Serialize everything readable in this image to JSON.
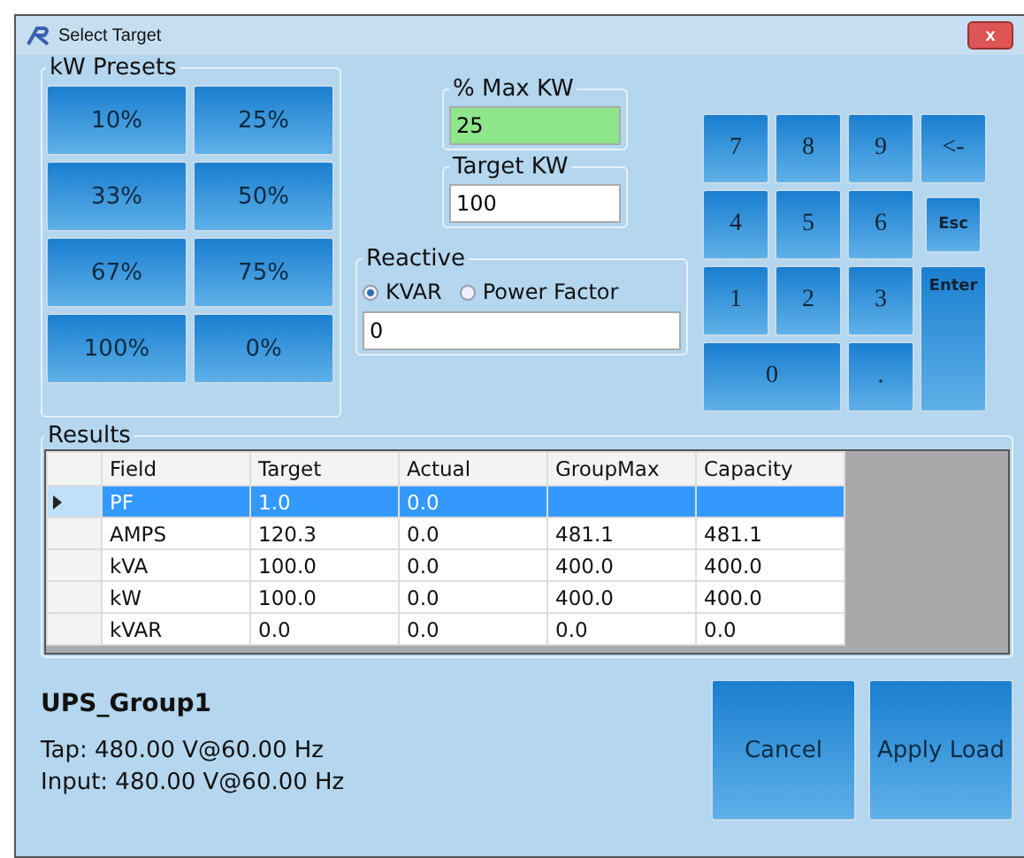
{
  "window": {
    "title": "Select Target",
    "close": "x"
  },
  "presets": {
    "title": "kW Presets",
    "buttons": [
      "10%",
      "25%",
      "33%",
      "50%",
      "67%",
      "75%",
      "100%",
      "0%"
    ]
  },
  "max_kw": {
    "label": "% Max KW",
    "value": "25"
  },
  "target_kw": {
    "label": "Target KW",
    "value": "100"
  },
  "reactive": {
    "title": "Reactive",
    "options": [
      {
        "label": "KVAR",
        "selected": true
      },
      {
        "label": "Power Factor",
        "selected": false
      }
    ],
    "value": "0"
  },
  "keypad": [
    {
      "label": "7",
      "kind": "key"
    },
    {
      "label": "8",
      "kind": "key"
    },
    {
      "label": "9",
      "kind": "key"
    },
    {
      "label": "<-",
      "kind": "key"
    },
    {
      "label": "4",
      "kind": "key"
    },
    {
      "label": "5",
      "kind": "key"
    },
    {
      "label": "6",
      "kind": "key"
    },
    {
      "label": "Esc",
      "kind": "small"
    },
    {
      "label": "1",
      "kind": "key"
    },
    {
      "label": "2",
      "kind": "key"
    },
    {
      "label": "3",
      "kind": "key"
    },
    {
      "label": "Enter",
      "kind": "tall"
    },
    {
      "label": "0",
      "kind": "wide"
    },
    {
      "label": ".",
      "kind": "key"
    }
  ],
  "results": {
    "title": "Results",
    "columns": [
      "Field",
      "Target",
      "Actual",
      "GroupMax",
      "Capacity"
    ],
    "rows": [
      {
        "cells": [
          "PF",
          "1.0",
          "0.0",
          "",
          ""
        ],
        "selected": true
      },
      {
        "cells": [
          "AMPS",
          "120.3",
          "0.0",
          "481.1",
          "481.1"
        ],
        "selected": false
      },
      {
        "cells": [
          "kVA",
          "100.0",
          "0.0",
          "400.0",
          "400.0"
        ],
        "selected": false
      },
      {
        "cells": [
          "kW",
          "100.0",
          "0.0",
          "400.0",
          "400.0"
        ],
        "selected": false
      },
      {
        "cells": [
          "kVAR",
          "0.0",
          "0.0",
          "0.0",
          "0.0"
        ],
        "selected": false
      }
    ]
  },
  "group": {
    "name": "UPS_Group1",
    "tap": "Tap: 480.00 V@60.00 Hz",
    "input": "Input: 480.00 V@60.00 Hz"
  },
  "buttons": [
    "Cancel",
    "Apply Load"
  ]
}
